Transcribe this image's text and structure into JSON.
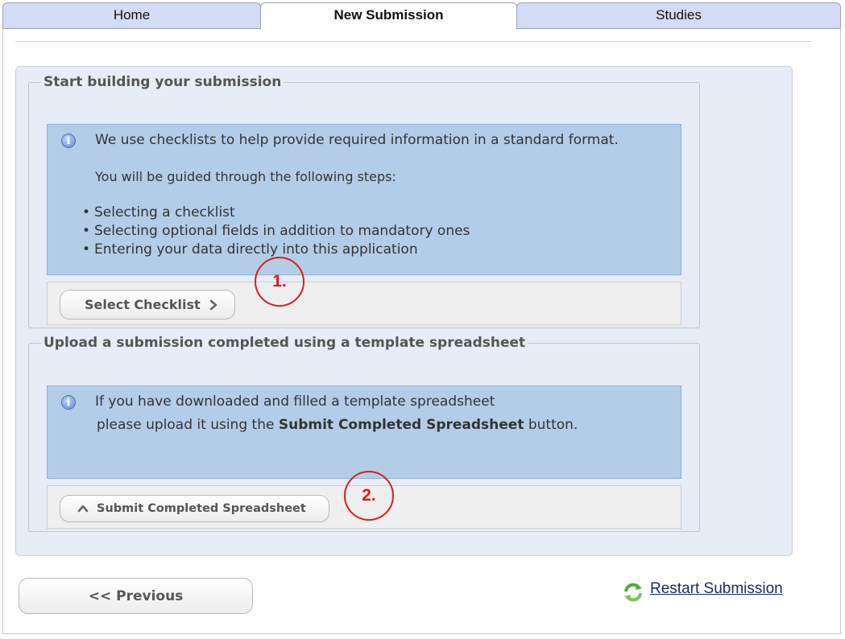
{
  "tabs": [
    {
      "label": "Home",
      "active": false
    },
    {
      "label": "New Submission",
      "active": true
    },
    {
      "label": "Studies",
      "active": false
    }
  ],
  "checklist_section": {
    "legend": "Start building your submission",
    "info_text": "We use checklists to help provide required information in a standard format.",
    "guide_text": "You will be guided through the following steps:",
    "steps": [
      "Selecting a checklist",
      "Selecting optional fields in addition to mandatory ones",
      "Entering your data directly into this application"
    ],
    "button_label": "Select Checklist",
    "annotation": "1."
  },
  "upload_section": {
    "legend": "Upload a submission completed using a template spreadsheet",
    "info_line1": "If you have downloaded and filled a template spreadsheet",
    "info_line2_prefix": "please upload it using the ",
    "info_line2_bold": "Submit Completed Spreadsheet",
    "info_line2_suffix": " button.",
    "button_label": "Submit Completed Spreadsheet",
    "annotation": "2."
  },
  "footer": {
    "previous_label": "<< Previous",
    "restart_label": "Restart Submission"
  },
  "icons": {
    "info": "info-icon",
    "chevron": "chevron-right-icon",
    "upload": "chevron-up-icon",
    "restart": "refresh-icon"
  },
  "colors": {
    "info_box": "#b3cde8",
    "tab_inactive": "#d4dcf5",
    "annotation_red": "#e01b1b",
    "link": "#1a2b6b"
  }
}
